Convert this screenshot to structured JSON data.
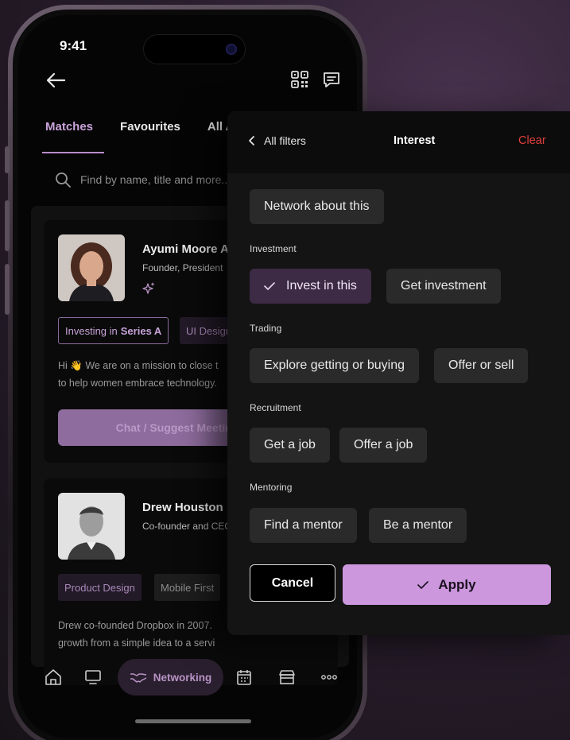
{
  "status": {
    "time": "9:41"
  },
  "tabs": [
    {
      "label": "Matches",
      "active": true
    },
    {
      "label": "Favourites",
      "active": false
    },
    {
      "label": "All A",
      "active": false
    }
  ],
  "search": {
    "placeholder": "Find by name, title and more..."
  },
  "cards": [
    {
      "name": "Ayumi Moore Ac",
      "role": "Founder, President",
      "chips": [
        {
          "prefix": "Investing in",
          "bold": "Series A"
        },
        {
          "label": "UI Design"
        }
      ],
      "text_lines": [
        "Hi 👋 We are on a mission to close t",
        "to help women embrace technology."
      ],
      "cta": "Chat / Suggest Meeting"
    },
    {
      "name": "Drew Houston",
      "role": "Co-founder and CEO",
      "chips": [
        {
          "label": "Product Design"
        },
        {
          "label": "Mobile First"
        }
      ],
      "text_lines": [
        "Drew co-founded Dropbox in 2007.",
        "growth from a simple idea to a servi"
      ]
    }
  ],
  "bottom_nav": {
    "items": [
      "home-icon",
      "desktop-icon",
      "networking-icon",
      "calendar-icon",
      "store-icon",
      "more-icon"
    ],
    "active_label": "Networking"
  },
  "filter_panel": {
    "back_label": "All filters",
    "title": "Interest",
    "clear_label": "Clear",
    "general_options": [
      "Network about this"
    ],
    "sections": [
      {
        "title": "Investment",
        "options": [
          {
            "label": "Invest in this",
            "selected": true
          },
          {
            "label": "Get investment",
            "selected": false
          }
        ]
      },
      {
        "title": "Trading",
        "options": [
          {
            "label": "Explore getting or buying",
            "selected": false
          },
          {
            "label": "Offer or sell",
            "selected": false
          }
        ]
      },
      {
        "title": "Recruitment",
        "options": [
          {
            "label": "Get a job",
            "selected": false
          },
          {
            "label": "Offer a job",
            "selected": false
          }
        ]
      },
      {
        "title": "Mentoring",
        "options": [
          {
            "label": "Find a mentor",
            "selected": false
          },
          {
            "label": "Be a mentor",
            "selected": false
          }
        ]
      }
    ],
    "cancel_label": "Cancel",
    "apply_label": "Apply"
  },
  "colors": {
    "accent": "#cc97dd",
    "accent_dark": "#3d2a45",
    "clear_red": "#e0403c",
    "background": "#141414"
  }
}
